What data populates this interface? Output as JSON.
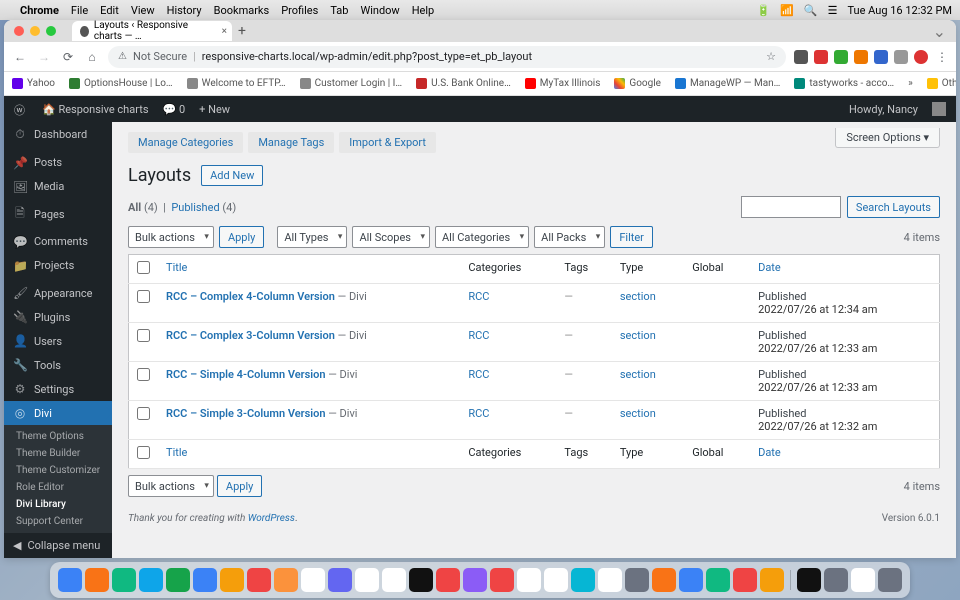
{
  "mac_menu": {
    "app": "Chrome",
    "items": [
      "File",
      "Edit",
      "View",
      "History",
      "Bookmarks",
      "Profiles",
      "Tab",
      "Window",
      "Help"
    ],
    "time": "Tue Aug 16  12:32 PM"
  },
  "chrome": {
    "tab_title": "Layouts ‹ Responsive charts — …",
    "security": "Not Secure",
    "url": "responsive-charts.local/wp-admin/edit.php?post_type=et_pb_layout",
    "bookmarks": [
      "Yahoo",
      "OptionsHouse | Lo…",
      "Welcome to EFTP…",
      "Customer Login | I…",
      "U.S. Bank Online…",
      "MyTax Illinois",
      "Google",
      "ManageWP — Man…",
      "tastyworks - acco…"
    ],
    "other_bookmarks": "Other Bookmarks"
  },
  "wp": {
    "site_name": "Responsive charts",
    "comments_count": "0",
    "new_label": "+  New",
    "howdy": "Howdy, Nancy",
    "screen_options": "Screen Options ▾",
    "menu": [
      {
        "icon": "⏱",
        "label": "Dashboard"
      },
      {
        "icon": "📌",
        "label": "Posts"
      },
      {
        "icon": "🖼",
        "label": "Media"
      },
      {
        "icon": "🗎",
        "label": "Pages"
      },
      {
        "icon": "💬",
        "label": "Comments"
      },
      {
        "icon": "📁",
        "label": "Projects"
      },
      {
        "icon": "🖌",
        "label": "Appearance"
      },
      {
        "icon": "🔌",
        "label": "Plugins"
      },
      {
        "icon": "👤",
        "label": "Users"
      },
      {
        "icon": "🔧",
        "label": "Tools"
      },
      {
        "icon": "⚙",
        "label": "Settings"
      }
    ],
    "divi": {
      "label": "Divi",
      "sub": [
        "Theme Options",
        "Theme Builder",
        "Theme Customizer",
        "Role Editor",
        "Divi Library",
        "Support Center"
      ],
      "active_sub": 4
    },
    "collapse": "Collapse menu",
    "tabs": [
      "Manage Categories",
      "Manage Tags",
      "Import & Export"
    ],
    "page_title": "Layouts",
    "add_new": "Add New",
    "views": {
      "all_label": "All",
      "all_count": "(4)",
      "published_label": "Published",
      "published_count": "(4)"
    },
    "search_btn": "Search Layouts",
    "bulk_actions": "Bulk actions",
    "apply": "Apply",
    "filters": [
      "All Types",
      "All Scopes",
      "All Categories",
      "All Packs"
    ],
    "filter_btn": "Filter",
    "item_count": "4 items",
    "columns": {
      "title": "Title",
      "categories": "Categories",
      "tags": "Tags",
      "type": "Type",
      "global": "Global",
      "date": "Date"
    },
    "rows": [
      {
        "title": "RCC – Complex 4-Column Version",
        "suffix": " — Divi",
        "cat": "RCC",
        "type": "section",
        "date_status": "Published",
        "date": "2022/07/26 at 12:34 am"
      },
      {
        "title": "RCC – Complex 3-Column Version",
        "suffix": " — Divi",
        "cat": "RCC",
        "type": "section",
        "date_status": "Published",
        "date": "2022/07/26 at 12:33 am"
      },
      {
        "title": "RCC – Simple 4-Column Version",
        "suffix": " — Divi",
        "cat": "RCC",
        "type": "section",
        "date_status": "Published",
        "date": "2022/07/26 at 12:33 am"
      },
      {
        "title": "RCC – Simple 3-Column Version",
        "suffix": " — Divi",
        "cat": "RCC",
        "type": "section",
        "date_status": "Published",
        "date": "2022/07/26 at 12:32 am"
      }
    ],
    "footer_thanks": "Thank you for creating with ",
    "footer_wp": "WordPress",
    "footer_period": ".",
    "version": "Version 6.0.1"
  },
  "colors": {
    "accent": "#2271b1"
  },
  "dock_colors": [
    "#3b82f6",
    "#f97316",
    "#10b981",
    "#0ea5e9",
    "#16a34a",
    "#3b82f6",
    "#f59e0b",
    "#ef4444",
    "#fb923c",
    "#fff",
    "#6366f1",
    "#fff",
    "#fff",
    "#111",
    "#ef4444",
    "#8b5cf6",
    "#ef4444",
    "#fff",
    "#fff",
    "#06b6d4",
    "#fff",
    "#6b7280",
    "#f97316",
    "#3b82f6",
    "#10b981",
    "#ef4444",
    "#f59e0b",
    "#111",
    "#6b7280",
    "#fff",
    "#6b7280"
  ]
}
